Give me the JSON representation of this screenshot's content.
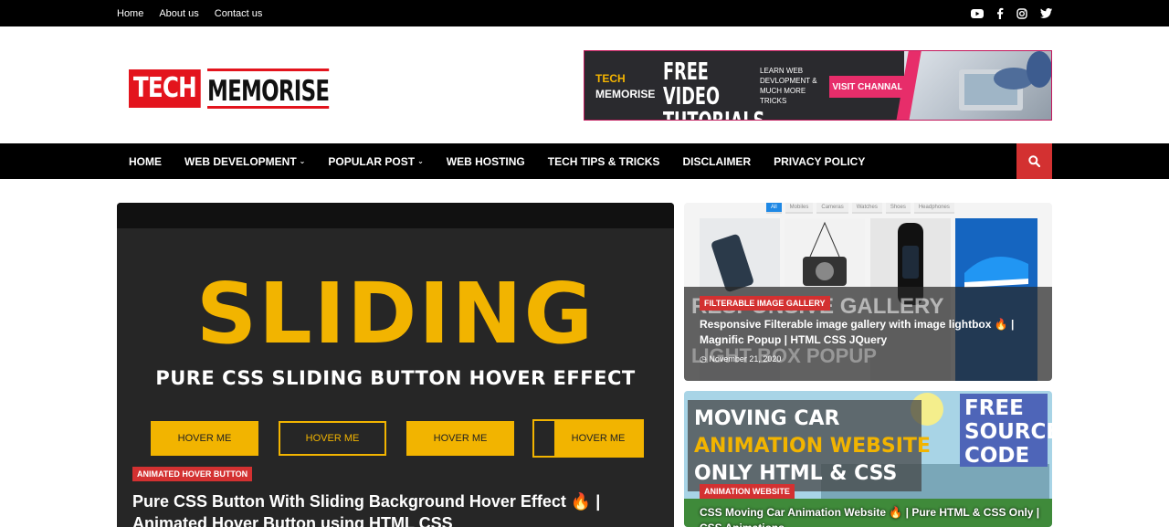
{
  "topbar": {
    "links": [
      "Home",
      "About us",
      "Contact us"
    ],
    "social_icons": [
      "youtube-icon",
      "facebook-icon",
      "instagram-icon",
      "twitter-icon"
    ]
  },
  "logo": {
    "part1": "TECH",
    "part2": "MEMORISE"
  },
  "banner": {
    "brand_line1": "TECH",
    "brand_line2": "MEMORISE",
    "headline": "FREE VIDEO TUTORIALS",
    "subtext": "LEARN WEB DEVLOPMENT & MUCH MORE TRICKS",
    "cta": "VISIT CHANNAL"
  },
  "nav": {
    "items": [
      {
        "label": "HOME",
        "has_dropdown": false
      },
      {
        "label": "WEB DEVELOPMENT",
        "has_dropdown": true
      },
      {
        "label": "POPULAR POST",
        "has_dropdown": true
      },
      {
        "label": "WEB HOSTING",
        "has_dropdown": false
      },
      {
        "label": "TECH TIPS & TRICKS",
        "has_dropdown": false
      },
      {
        "label": "DISCLAIMER",
        "has_dropdown": false
      },
      {
        "label": "PRIVACY POLICY",
        "has_dropdown": false
      }
    ],
    "search_icon": "search-icon"
  },
  "feature": {
    "image_heading": "SLIDING",
    "image_subheading": "PURE CSS SLIDING BUTTON HOVER EFFECT",
    "demo_buttons": [
      "HOVER ME",
      "HOVER ME",
      "HOVER ME",
      "HOVER ME"
    ],
    "badge": "ANIMATED HOVER BUTTON",
    "title": "Pure CSS Button With Sliding Background Hover Effect 🔥 | Animated Hover Button using HTML CSS"
  },
  "posts": [
    {
      "filters": [
        "All",
        "Mobiles",
        "Cameras",
        "Watches",
        "Shoes",
        "Headphones"
      ],
      "image_text_1": "RESPONSIVE GALLERY",
      "image_text_2": "LIGHT BOX POPUP",
      "badge": "FILTERABLE IMAGE GALLERY",
      "title": "Responsive Filterable image gallery with image lightbox 🔥 | Magnific Popup | HTML CSS JQuery",
      "date": "November 21, 2020"
    },
    {
      "image_line_1": "MOVING CAR",
      "image_line_2": "ANIMATION WEBSITE",
      "image_line_3": "ONLY HTML & CSS",
      "image_free": "FREE SOURCE CODE",
      "badge": "ANIMATION WEBSITE",
      "title": "CSS Moving Car Animation Website 🔥 | Pure HTML & CSS Only | CSS Animations"
    }
  ],
  "colors": {
    "accent": "#d33131",
    "yellow": "#f2b400",
    "dark": "#000000"
  }
}
